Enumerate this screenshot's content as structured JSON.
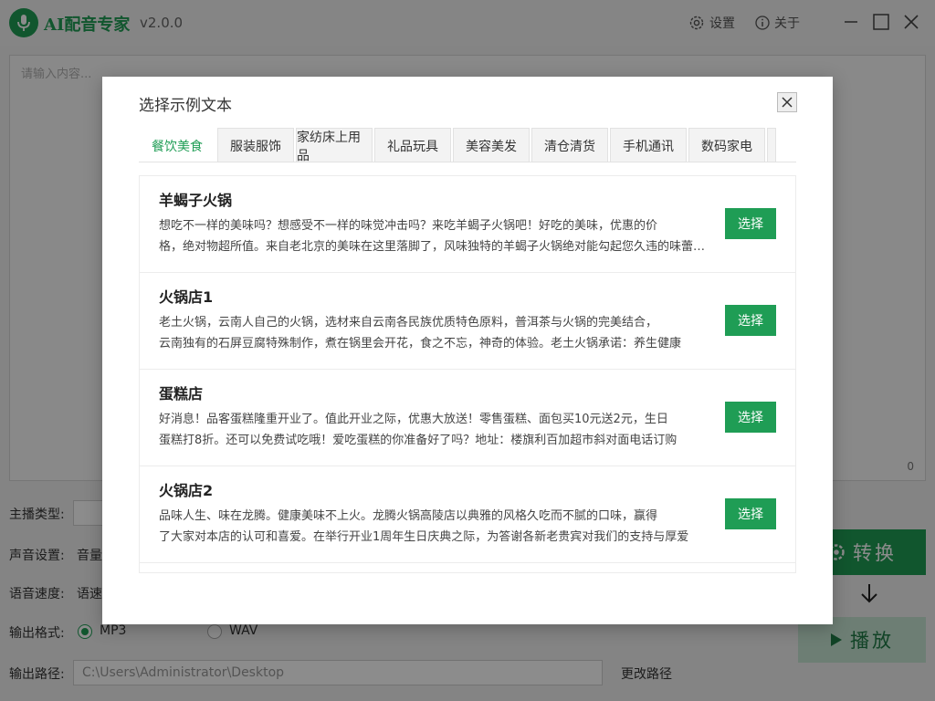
{
  "app": {
    "title": "AI配音专家",
    "version": "v2.0.0",
    "settings_label": "设置",
    "about_label": "关于"
  },
  "editor": {
    "placeholder": "请输入内容...",
    "char_count": "0"
  },
  "form": {
    "anchor_type_label": "主播类型:",
    "voice_settings_label": "声音设置:",
    "volume_label": "音量",
    "speech_speed_label": "语音速度:",
    "speed_label": "语速",
    "output_format_label": "输出格式:",
    "format_options": [
      "MP3",
      "WAV"
    ],
    "selected_format": "MP3",
    "output_path_label": "输出路径:",
    "output_path_value": "C:\\Users\\Administrator\\Desktop",
    "change_path_label": "更改路径"
  },
  "actions": {
    "convert_label": "转换",
    "play_label": "播放"
  },
  "modal": {
    "title": "选择示例文本",
    "tabs": [
      {
        "label": "餐饮美食",
        "active": true
      },
      {
        "label": "服装服饰",
        "active": false
      },
      {
        "label": "家纺床上用品",
        "active": false
      },
      {
        "label": "礼品玩具",
        "active": false
      },
      {
        "label": "美容美发",
        "active": false
      },
      {
        "label": "清仓清货",
        "active": false
      },
      {
        "label": "手机通讯",
        "active": false
      },
      {
        "label": "数码家电",
        "active": false
      }
    ],
    "items": [
      {
        "title": "羊蝎子火锅",
        "desc_line1": "想吃不一样的美味吗？想感受不一样的味觉冲击吗？来吃羊蝎子火锅吧！好吃的美味，优惠的价",
        "desc_line2": "格，绝对物超所值。来自老北京的美味在这里落脚了，风味独特的羊蝎子火锅绝对能勾起您久违的味蕾记忆",
        "button": "选择"
      },
      {
        "title": "火锅店1",
        "desc_line1": "老土火锅，云南人自己的火锅，选材来自云南各民族优质特色原料，普洱茶与火锅的完美结合，",
        "desc_line2": "云南独有的石屏豆腐特殊制作，煮在锅里会开花，食之不忘，神奇的体验。老土火锅承诺：养生健康",
        "button": "选择"
      },
      {
        "title": "蛋糕店",
        "desc_line1": "好消息！品客蛋糕隆重开业了。值此开业之际，优惠大放送！零售蛋糕、面包买10元送2元，生日",
        "desc_line2": "蛋糕打8折。还可以免费试吃哦！爱吃蛋糕的你准备好了吗？地址：楼旗利百加超市斜对面电话订购",
        "button": "选择"
      },
      {
        "title": "火锅店2",
        "desc_line1": "品味人生、味在龙腾。健康美味不上火。龙腾火锅高陵店以典雅的风格久吃而不腻的口味，赢得",
        "desc_line2": "了大家对本店的认可和喜爱。在举行开业1周年生日庆典之际，为答谢各新老贵宾对我们的支持与厚爱",
        "button": "选择"
      }
    ]
  }
}
